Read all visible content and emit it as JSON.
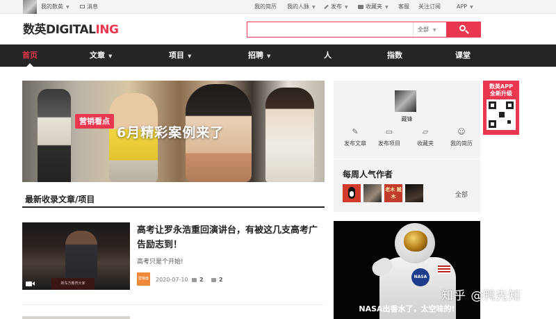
{
  "topbar": {
    "my_shuying": "我的数英",
    "messages": "消息",
    "my_resume": "我的简历",
    "my_network": "我的人脉",
    "publish": "发布",
    "favorites": "收藏夹",
    "support": "客服",
    "subscribe": "关注订阅",
    "app": "APP"
  },
  "logo": {
    "part1": "数英",
    "part2": "DIGITAL",
    "part3": "ING"
  },
  "search": {
    "placeholder": "",
    "scope": "全部",
    "button_icon": "search-icon"
  },
  "nav": {
    "items": [
      {
        "label": "首页",
        "active": true
      },
      {
        "label": "文章"
      },
      {
        "label": "项目"
      },
      {
        "label": "招聘"
      },
      {
        "label": "人"
      },
      {
        "label": "指数"
      },
      {
        "label": "课堂"
      }
    ]
  },
  "banner": {
    "tag": "营销看点",
    "title": "6月精彩案例来了"
  },
  "profile": {
    "name": "藏锋",
    "actions": [
      {
        "label": "发布文章",
        "icon": "edit-icon"
      },
      {
        "label": "发布项目",
        "icon": "briefcase-icon"
      },
      {
        "label": "收藏夹",
        "icon": "folder-icon"
      },
      {
        "label": "我的简历",
        "icon": "user-icon"
      }
    ]
  },
  "authors": {
    "title": "每周人气作者",
    "all_label": "全部",
    "avatar_text": "老木 贼木"
  },
  "qr_promo": {
    "line1": "数英APP",
    "line2": "全新升级"
  },
  "section": {
    "title": "最新收录文章/项目"
  },
  "article": {
    "title": "高考让罗永浩重回演讲台，有被这几支高考广告励志到！",
    "desc": "高考只是个开始!",
    "source_badge": "营销兽",
    "date": "2020-07-10",
    "likes": "2",
    "favorites": "2",
    "podium_text": "新东方教育大家"
  },
  "meme": {
    "caption": "NASA出香水了，太空味的!",
    "badge": "NASA"
  },
  "watermark": "知乎 @鸭先知",
  "colors": {
    "accent": "#e8374e",
    "nav_bg": "#252525",
    "card_bg": "#f3f3f3"
  }
}
